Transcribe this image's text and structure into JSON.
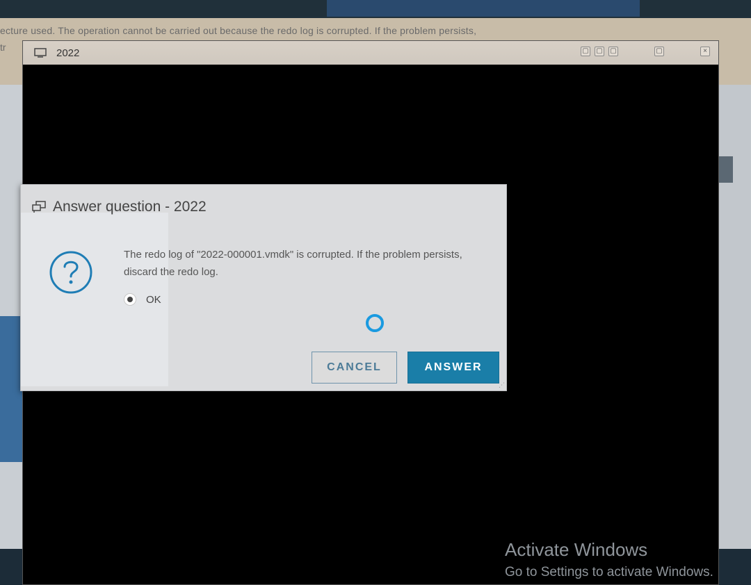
{
  "background": {
    "banner_line_1": "ecture used. The operation cannot be carried out because the redo log is corrupted. If the problem persists,",
    "banner_line_2": "tr"
  },
  "console": {
    "title": "2022",
    "controls": [
      "▢",
      "▢",
      "▢",
      "",
      "▢",
      "",
      "×"
    ]
  },
  "dialog": {
    "title": "Answer question - 2022",
    "message": "The redo log of \"2022-000001.vmdk\" is corrupted. If the problem persists, discard the redo log.",
    "options": [
      {
        "label": "OK",
        "selected": true
      }
    ],
    "cancel_label": "CANCEL",
    "answer_label": "ANSWER"
  },
  "watermark": {
    "title": "Activate Windows",
    "subtitle": "Go to Settings to activate Windows."
  },
  "colors": {
    "accent": "#1a7ea8",
    "spinner": "#1a9ae0",
    "question_icon": "#1f7db5"
  },
  "icons": {
    "console": "monitor-icon",
    "dialog": "chat-bubbles-icon",
    "question": "question-circle-icon",
    "loading": "spinner-icon"
  }
}
